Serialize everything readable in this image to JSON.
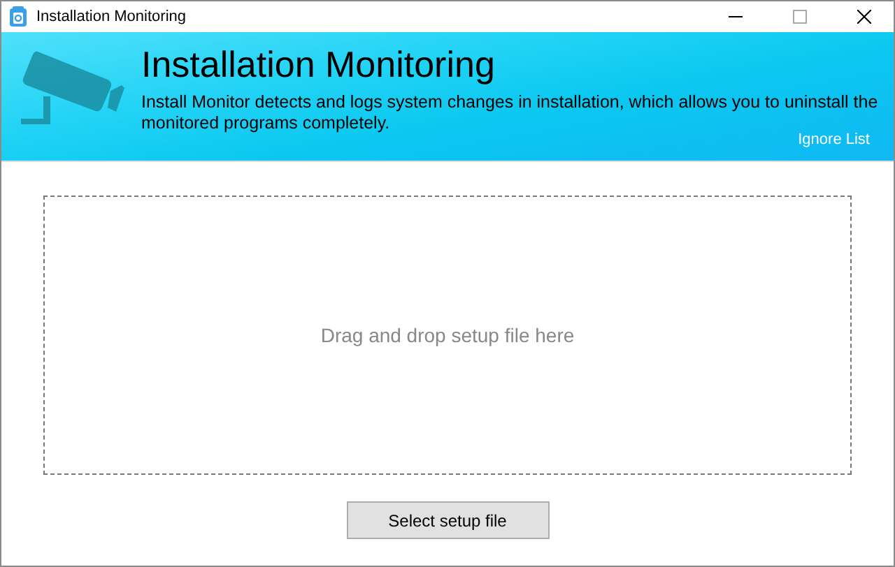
{
  "window": {
    "title": "Installation Monitoring"
  },
  "header": {
    "title": "Installation Monitoring",
    "description": "Install Monitor detects and logs system changes in installation, which allows you to uninstall the monitored programs completely.",
    "link": "Ignore List"
  },
  "drop_zone": {
    "text": "Drag and drop setup file here"
  },
  "buttons": [
    "Select setup file"
  ]
}
